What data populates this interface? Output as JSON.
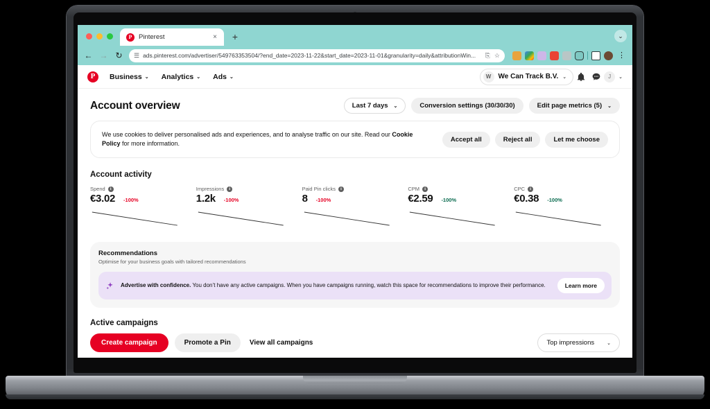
{
  "browser": {
    "tab": {
      "title": "Pinterest",
      "favicon": "pinterest-icon",
      "close": "×"
    },
    "new_tab": "+",
    "window_control": "⌄",
    "nav": {
      "back": "←",
      "forward": "→",
      "reload": "↻"
    },
    "omnibox": {
      "site_icon": "page-info-icon",
      "url": "ads.pinterest.com/advertiser/549763353504/?end_date=2023-11-22&start_date=2023-11-01&granularity=daily&attributionWin...",
      "cast_icon": "⎘",
      "bookmark_icon": "☆"
    },
    "extensions": [
      "extension-orange-icon",
      "google-icon",
      "extension-purple-icon",
      "extension-red-icon",
      "extension-gray-icon",
      "extension-puzzle-icon",
      "side-panel-icon",
      "profile-avatar-icon"
    ],
    "menu": "⋮"
  },
  "appnav": {
    "logo": "pinterest-logo",
    "items": [
      {
        "label": "Business",
        "caret": "⌄"
      },
      {
        "label": "Analytics",
        "caret": "⌄"
      },
      {
        "label": "Ads",
        "caret": "⌄"
      }
    ],
    "account": {
      "avatar": "W",
      "name": "We Can Track B.V.",
      "caret": "⌄"
    },
    "notifications_icon": "bell-icon",
    "messages_icon": "chat-bubble-icon",
    "user_avatar": "J",
    "user_caret": "⌄"
  },
  "header": {
    "title": "Account overview",
    "date_range": {
      "label": "Last 7 days",
      "caret": "⌄"
    },
    "conversion_settings": "Conversion settings (30/30/30)",
    "edit_metrics": {
      "label": "Edit page metrics (5)",
      "caret": "⌄"
    }
  },
  "cookie_banner": {
    "text_before": "We use cookies to deliver personalised ads and experiences, and to analyse traffic on our site. Read our ",
    "policy_link": "Cookie Policy",
    "text_after": " for more information.",
    "accept": "Accept all",
    "reject": "Reject all",
    "choose": "Let me choose"
  },
  "account_activity": {
    "title": "Account activity",
    "metrics": [
      {
        "label": "Spend",
        "value": "€3.02",
        "delta": "-100%",
        "delta_color": "#e60023"
      },
      {
        "label": "Impressions",
        "value": "1.2k",
        "delta": "-100%",
        "delta_color": "#e60023"
      },
      {
        "label": "Paid Pin clicks",
        "value": "8",
        "delta": "-100%",
        "delta_color": "#e60023"
      },
      {
        "label": "CPM",
        "value": "€2.59",
        "delta": "-100%",
        "delta_color": "#0a6b4f"
      },
      {
        "label": "CPC",
        "value": "€0.38",
        "delta": "-100%",
        "delta_color": "#0a6b4f"
      }
    ]
  },
  "recommendations": {
    "title": "Recommendations",
    "subtitle": "Optimise for your business goals with tailored recommendations",
    "banner": {
      "icon": "sparkle-icon",
      "headline": "Advertise with confidence.",
      "body": " You don’t have any active campaigns. When you have campaigns running, watch this space for recommendations to improve their performance.",
      "cta": "Learn more",
      "background": "#ebe1f7"
    }
  },
  "active_campaigns": {
    "title": "Active campaigns",
    "create": "Create campaign",
    "promote": "Promote a Pin",
    "view_all": "View all campaigns",
    "sort": {
      "label": "Top impressions",
      "caret": "⌄"
    }
  },
  "theme": {
    "brand_red": "#e60023",
    "chrome_teal": "#8fd6d1",
    "positive_green": "#0a6b4f",
    "negative_red": "#e60023"
  }
}
